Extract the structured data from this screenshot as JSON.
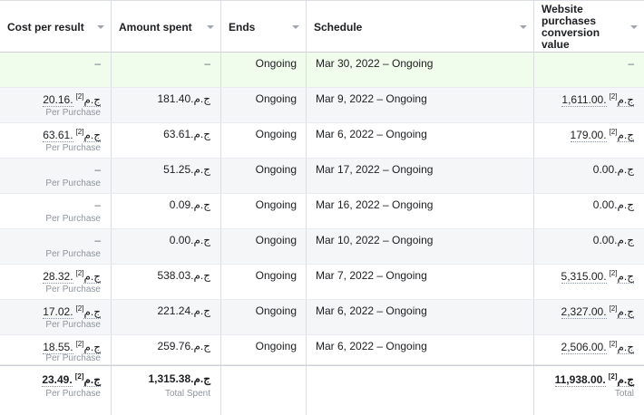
{
  "headers": [
    "Cost per result",
    "Amount spent",
    "Ends",
    "Schedule",
    "Website purchases conversion value"
  ],
  "footnote": "[2]",
  "rows": [
    {
      "cost": "–",
      "cost_sub": "",
      "spent": "–",
      "ends": "Ongoing",
      "schedule": "Mar 30, 2022 – Ongoing",
      "value": "–"
    },
    {
      "cost": "20.16.ج.م",
      "cost_sub": "Per Purchase",
      "spent": "181.40.ج.م",
      "ends": "Ongoing",
      "schedule": "Mar 9, 2022 – Ongoing",
      "value": "1,611.00.ج.م"
    },
    {
      "cost": "63.61.ج.م",
      "cost_sub": "Per Purchase",
      "spent": "63.61.ج.م",
      "ends": "Ongoing",
      "schedule": "Mar 6, 2022 – Ongoing",
      "value": "179.00.ج.م"
    },
    {
      "cost": "–",
      "cost_sub": "Per Purchase",
      "spent": "51.25.ج.م",
      "ends": "Ongoing",
      "schedule": "Mar 17, 2022 – Ongoing",
      "value": "0.00.ج.م"
    },
    {
      "cost": "–",
      "cost_sub": "Per Purchase",
      "spent": "0.09.ج.م",
      "ends": "Ongoing",
      "schedule": "Mar 16, 2022 – Ongoing",
      "value": "0.00.ج.م"
    },
    {
      "cost": "–",
      "cost_sub": "Per Purchase",
      "spent": "0.00.ج.م",
      "ends": "Ongoing",
      "schedule": "Mar 10, 2022 – Ongoing",
      "value": "0.00.ج.م"
    },
    {
      "cost": "28.32.ج.م",
      "cost_sub": "Per Purchase",
      "spent": "538.03.ج.م",
      "ends": "Ongoing",
      "schedule": "Mar 7, 2022 – Ongoing",
      "value": "5,315.00.ج.م"
    },
    {
      "cost": "17.02.ج.م",
      "cost_sub": "Per Purchase",
      "spent": "221.24.ج.م",
      "ends": "Ongoing",
      "schedule": "Mar 6, 2022 – Ongoing",
      "value": "2,327.00.ج.م"
    },
    {
      "cost": "18.55.ج.م",
      "cost_sub": "Per Purchase",
      "spent": "259.76.ج.م",
      "ends": "Ongoing",
      "schedule": "Mar 6, 2022 – Ongoing",
      "value": "2,506.00.ج.م"
    }
  ],
  "totals": {
    "cost": "23.49.ج.م",
    "cost_sub": "Per Purchase",
    "spent": "1,315.38.ج.م",
    "spent_sub": "Total Spent",
    "value": "11,938.00.ج.م",
    "value_sub": "Total"
  }
}
